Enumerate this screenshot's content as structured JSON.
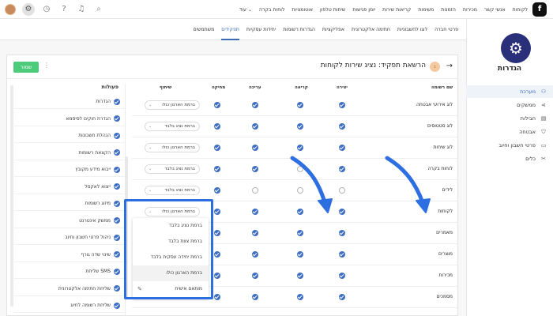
{
  "topbar": {
    "logo_letter": "f",
    "nav": [
      "לקוחות",
      "אנשי קשר",
      "מכירות",
      "הזמנות",
      "משימות",
      "קריאות שירות",
      "יומן פגישות",
      "שיחות טלפון",
      "אוטומציות",
      "לוחות בקרה",
      "עוד ⌄"
    ]
  },
  "sidebar": {
    "title": "הגדרות",
    "items": [
      {
        "label": "מערכת",
        "icon": "network-icon",
        "active": true
      },
      {
        "label": "ממשקים",
        "icon": "share-icon",
        "active": false
      },
      {
        "label": "חבילות",
        "icon": "package-icon",
        "active": false
      },
      {
        "label": "אבטחה",
        "icon": "shield-icon",
        "active": false
      },
      {
        "label": "פרטי חשבון וחיוב",
        "icon": "card-icon",
        "active": false
      },
      {
        "label": "כלים",
        "icon": "tools-icon",
        "active": false
      }
    ]
  },
  "subtabs": [
    {
      "label": "משתמשים",
      "active": false
    },
    {
      "label": "תפקידים",
      "active": true
    },
    {
      "label": "יחידות עסקיות",
      "active": false
    },
    {
      "label": "הגדרות רשומות",
      "active": false
    },
    {
      "label": "אפליקציות",
      "active": false
    },
    {
      "label": "חתימה אלקטרונית",
      "active": false
    },
    {
      "label": "לוגו לחשבוניות",
      "active": false
    },
    {
      "label": "פרטי חברה",
      "active": false
    }
  ],
  "panel": {
    "title": "הרשאת תפקיד: נציג שירות לקוחות",
    "badge": "נ",
    "save_label": "שמור"
  },
  "actions": {
    "header": "פעולות",
    "items": [
      "הגדרות",
      "הגדרת חוקים לסיסמא",
      "הנהלת חשבונות",
      "הקצאת רשומות",
      "ייבוא מידע מקובץ",
      "ייצוא לאקסל",
      "מיזוג רשומות",
      "ממשק אינטרנט",
      "ניהול פרטי חשבון וחיוב",
      "שינוי שדה גורף",
      "שליחת SMS",
      "שליחת חתימה אלקטרונית",
      "שליחת רשומה לחיוג"
    ]
  },
  "permissions": {
    "headers": {
      "name": "שם רשומה",
      "create": "יצירה",
      "read": "קריאה",
      "edit": "עריכה",
      "delete": "מחיקה",
      "share": "שיתוף"
    },
    "rows": [
      {
        "name": "לוג אירועי אבטחה",
        "create": true,
        "read": true,
        "edit": true,
        "delete": true,
        "share": "ברמת הארגון כולו"
      },
      {
        "name": "לוג סטטוסים",
        "create": true,
        "read": true,
        "edit": true,
        "delete": true,
        "share": "ברמת נציג בלבד"
      },
      {
        "name": "לוג שיחות",
        "create": true,
        "read": true,
        "edit": true,
        "delete": true,
        "share": "ברמת הארגון כולו"
      },
      {
        "name": "לוחות בקרה",
        "create": true,
        "read": false,
        "edit": true,
        "delete": true,
        "share": "ברמת נציג בלבד"
      },
      {
        "name": "לידים",
        "create": false,
        "read": false,
        "edit": false,
        "delete": true,
        "share": "ברמת נציג בלבד"
      },
      {
        "name": "לקוחות",
        "create": true,
        "read": true,
        "edit": true,
        "delete": true,
        "share": "ברמת הארגון כולו"
      },
      {
        "name": "מאמרים",
        "create": true,
        "read": true,
        "edit": true,
        "delete": true,
        "share": ""
      },
      {
        "name": "מוצרים",
        "create": true,
        "read": true,
        "edit": true,
        "delete": true,
        "share": ""
      },
      {
        "name": "מכירות",
        "create": true,
        "read": true,
        "edit": true,
        "delete": true,
        "share": ""
      },
      {
        "name": "מסמכים",
        "create": true,
        "read": true,
        "edit": true,
        "delete": true,
        "share": ""
      }
    ]
  },
  "dropdown": {
    "items": [
      {
        "label": "ברמת נציג בלבד",
        "selected": false
      },
      {
        "label": "ברמת צוות בלבד",
        "selected": false
      },
      {
        "label": "ברמת יחידה עסקית בלבד",
        "selected": false
      },
      {
        "label": "ברמת הארגון כולו",
        "selected": true
      },
      {
        "label": "מותאם אישית",
        "selected": false
      }
    ]
  },
  "colors": {
    "accent": "#3f6fc3",
    "highlight": "#2d6fe0",
    "save": "#4ccc7a",
    "hero": "#2a2f7a"
  }
}
